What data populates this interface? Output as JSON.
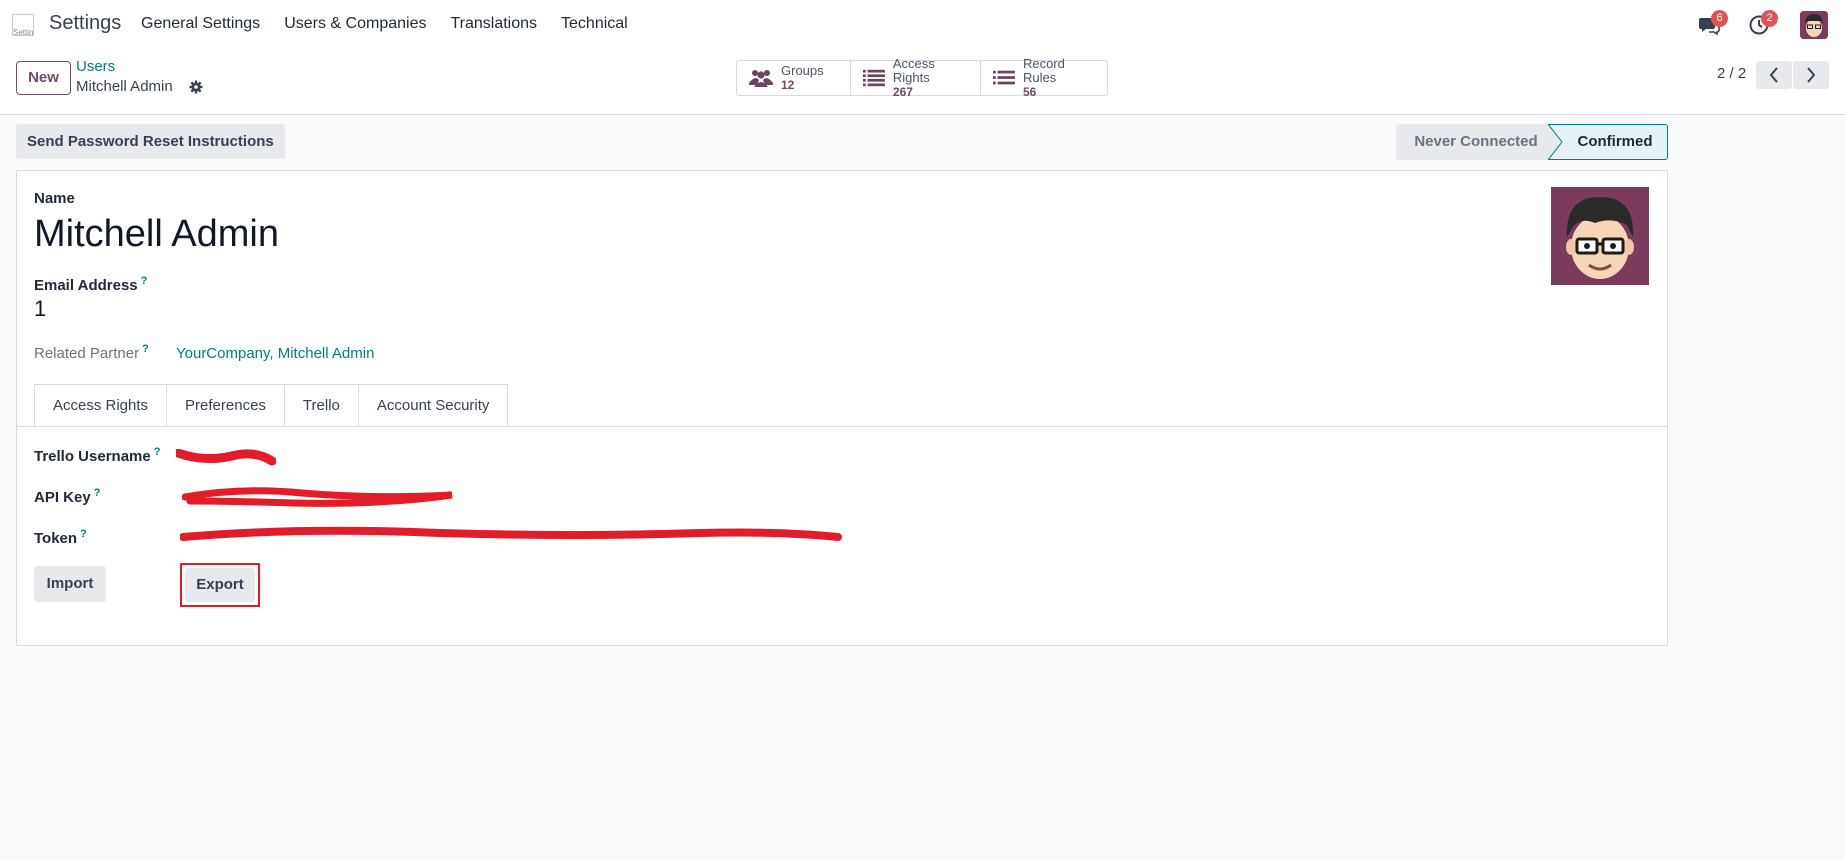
{
  "navbar": {
    "logo_alt": "Settings",
    "app_title": "Settings",
    "menu": [
      "General Settings",
      "Users & Companies",
      "Translations",
      "Technical"
    ],
    "messages_badge": "6",
    "activities_badge": "2"
  },
  "control": {
    "new_label": "New",
    "breadcrumb_parent": "Users",
    "record_name": "Mitchell Admin",
    "stats": [
      {
        "label": "Groups",
        "value": "12",
        "icon": "users-icon"
      },
      {
        "label": "Access Rights",
        "value": "267",
        "icon": "list-icon"
      },
      {
        "label": "Record Rules",
        "value": "56",
        "icon": "list-icon"
      }
    ],
    "pager": "2 / 2"
  },
  "actions": {
    "reset_label": "Send Password Reset Instructions",
    "status_never": "Never Connected",
    "status_confirmed": "Confirmed"
  },
  "form": {
    "name_label": "Name",
    "name_value": "Mitchell Admin",
    "email_label": "Email Address",
    "email_value": "1",
    "partner_label": "Related Partner",
    "partner_value": "YourCompany, Mitchell Admin",
    "tabs": [
      "Access Rights",
      "Preferences",
      "Trello",
      "Account Security"
    ],
    "active_tab": "Trello",
    "trello": {
      "username_label": "Trello Username",
      "api_key_label": "API Key",
      "token_label": "Token",
      "username_value": "",
      "api_key_value": "",
      "token_value": ""
    },
    "import_label": "Import",
    "export_label": "Export"
  },
  "colors": {
    "brand": "#714b67",
    "link": "#017e84",
    "badge": "#e45353",
    "redaction": "#e11d2a"
  }
}
